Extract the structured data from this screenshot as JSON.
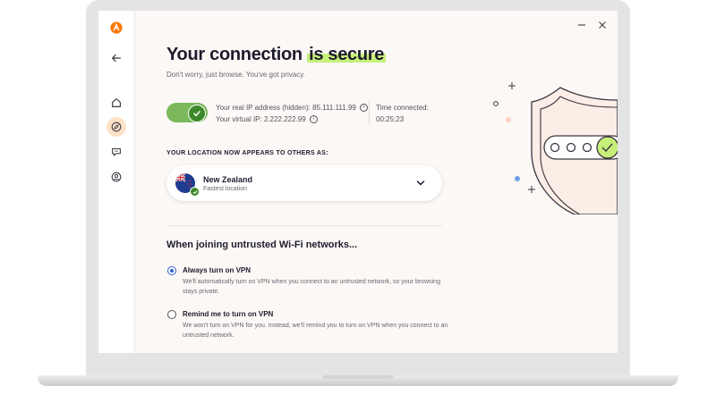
{
  "app": {
    "logo_icon": "avast-logo-icon",
    "brand_color": "#ff7800"
  },
  "window": {
    "minimize_icon": "minimize-icon",
    "close_icon": "close-icon"
  },
  "sidebar": {
    "items": [
      {
        "icon": "back-arrow-icon"
      },
      {
        "icon": "home-icon"
      },
      {
        "icon": "compass-icon",
        "active": true
      },
      {
        "icon": "chat-icon"
      },
      {
        "icon": "account-icon"
      }
    ]
  },
  "status": {
    "title_prefix": "Your connection",
    "title_highlight": "is secure",
    "subtitle": "Don't worry, just browse. You've got privacy.",
    "toggle_on": true,
    "real_ip": "Your real IP address (hidden): 85.111.111.99",
    "virtual_ip": "Your virtual IP: 2.222.222.99",
    "time_label": "Time connected:",
    "time_value": "00:25:23"
  },
  "location": {
    "heading": "YOUR LOCATION NOW APPEARS TO OTHERS AS:",
    "name": "New Zealand",
    "sub": "Fastest location",
    "flag_icon": "new-zealand-flag-icon"
  },
  "wifi": {
    "heading": "When joining untrusted Wi-Fi networks...",
    "options": [
      {
        "title": "Always turn on VPN",
        "desc": "We'll automatically turn on VPN when you connect to an untrusted network, so your browsing stays private.",
        "checked": true
      },
      {
        "title": "Remind me to turn on VPN",
        "desc": "We won't turn on VPN for you. Instead, we'll remind you to turn on VPN when you connect to an untrusted network.",
        "checked": false
      }
    ]
  },
  "colors": {
    "accent_green": "#c6f07a",
    "toggle_green": "#7ab85a",
    "radio_blue": "#2f5fd0"
  }
}
